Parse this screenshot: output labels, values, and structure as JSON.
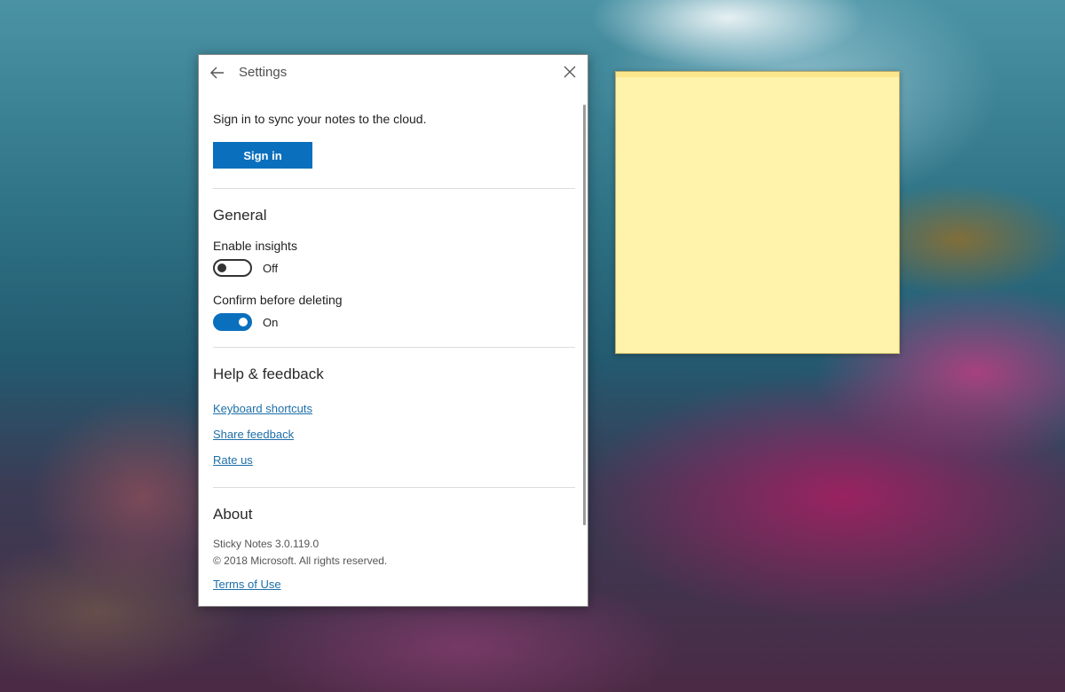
{
  "window": {
    "title": "Settings"
  },
  "sync": {
    "message": "Sign in to sync your notes to the cloud.",
    "sign_in_label": "Sign in"
  },
  "general": {
    "heading": "General",
    "insights": {
      "label": "Enable insights",
      "enabled": false,
      "state_label": "Off"
    },
    "confirm_delete": {
      "label": "Confirm before deleting",
      "enabled": true,
      "state_label": "On"
    }
  },
  "help": {
    "heading": "Help & feedback",
    "links": [
      "Keyboard shortcuts",
      "Share feedback",
      "Rate us"
    ]
  },
  "about": {
    "heading": "About",
    "version": "Sticky Notes 3.0.119.0",
    "copyright": "© 2018 Microsoft. All rights reserved.",
    "terms_link": "Terms of Use"
  },
  "icons": {
    "back": "back-arrow-icon",
    "close": "close-icon"
  },
  "colors": {
    "accent": "#0a6fbd",
    "link": "#1d6fa8",
    "sticky_note": "#fff2ab"
  }
}
